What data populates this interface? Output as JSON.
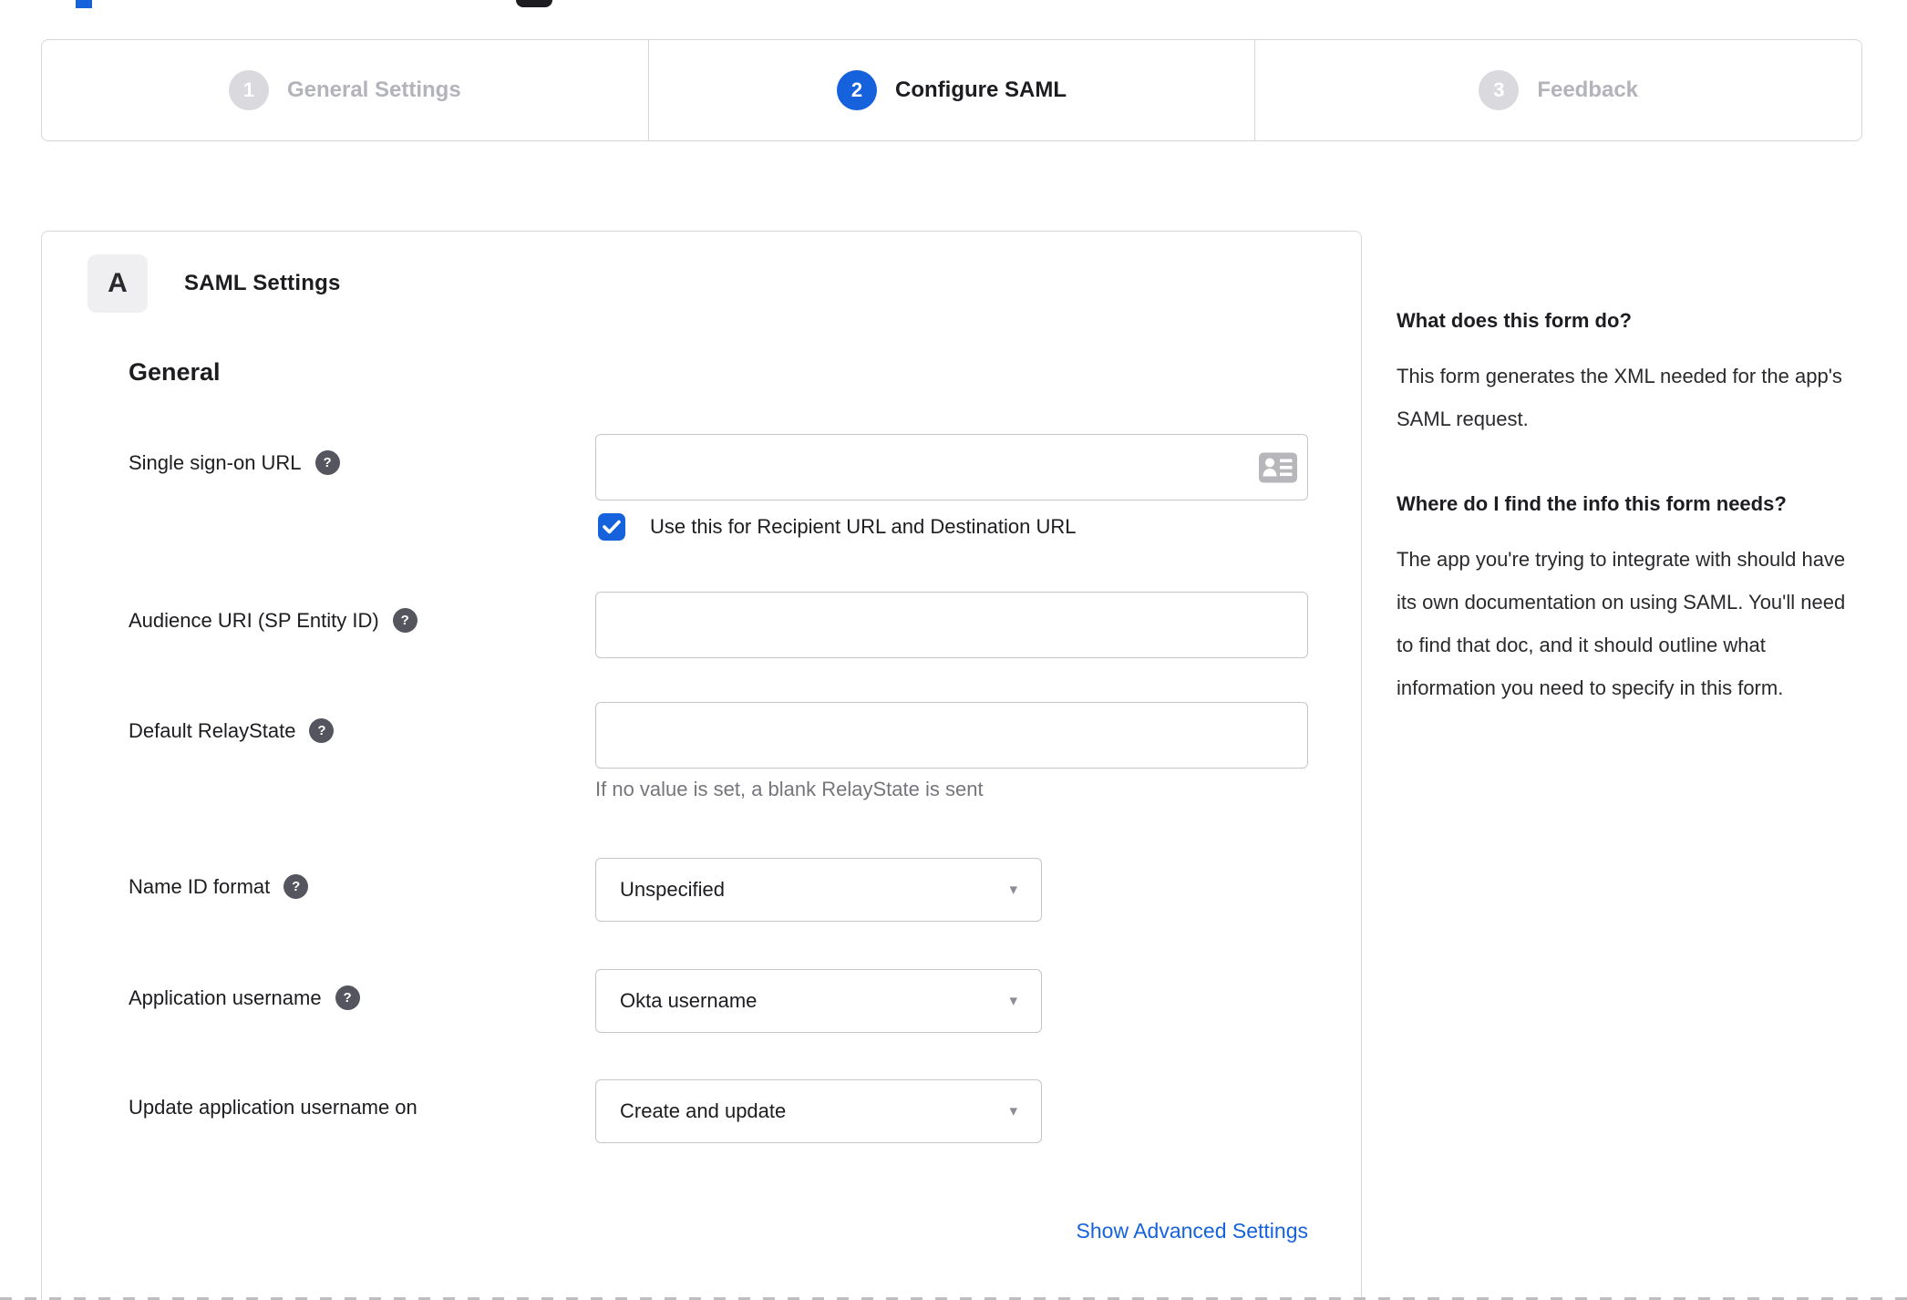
{
  "icons": {
    "help": "?",
    "caret": "▾"
  },
  "colors": {
    "accent_blue": "#1662dd",
    "inactive_gray": "#b3b3ba",
    "border_gray": "#d7d7da",
    "text_dark": "#1d1d21",
    "hint_gray": "#75757c"
  },
  "stepper": {
    "steps": [
      {
        "number": "1",
        "label": "General Settings",
        "state": "inactive"
      },
      {
        "number": "2",
        "label": "Configure SAML",
        "state": "active"
      },
      {
        "number": "3",
        "label": "Feedback",
        "state": "inactive"
      }
    ]
  },
  "panel": {
    "section_badge": "A",
    "section_title": "SAML Settings",
    "group_title": "General",
    "fields": [
      {
        "label": "Single sign-on URL",
        "type": "text",
        "value": "",
        "has_help": true,
        "checkbox": {
          "checked": true,
          "label": "Use this for Recipient URL and Destination URL"
        }
      },
      {
        "label": "Audience URI (SP Entity ID)",
        "type": "text",
        "value": "",
        "has_help": true
      },
      {
        "label": "Default RelayState",
        "type": "text",
        "value": "",
        "has_help": true,
        "hint": "If no value is set, a blank RelayState is sent"
      },
      {
        "label": "Name ID format",
        "type": "select",
        "value": "Unspecified",
        "has_help": true
      },
      {
        "label": "Application username",
        "type": "select",
        "value": "Okta username",
        "has_help": true
      },
      {
        "label": "Update application username on",
        "type": "select",
        "value": "Create and update",
        "has_help": false
      }
    ],
    "advanced_link": "Show Advanced Settings"
  },
  "sidebar": {
    "sections": [
      {
        "heading": "What does this form do?",
        "body": "This form generates the XML needed for the app's SAML request."
      },
      {
        "heading": "Where do I find the info this form needs?",
        "body": "The app you're trying to integrate with should have its own documentation on using SAML. You'll need to find that doc, and it should outline what information you need to specify in this form."
      }
    ]
  }
}
